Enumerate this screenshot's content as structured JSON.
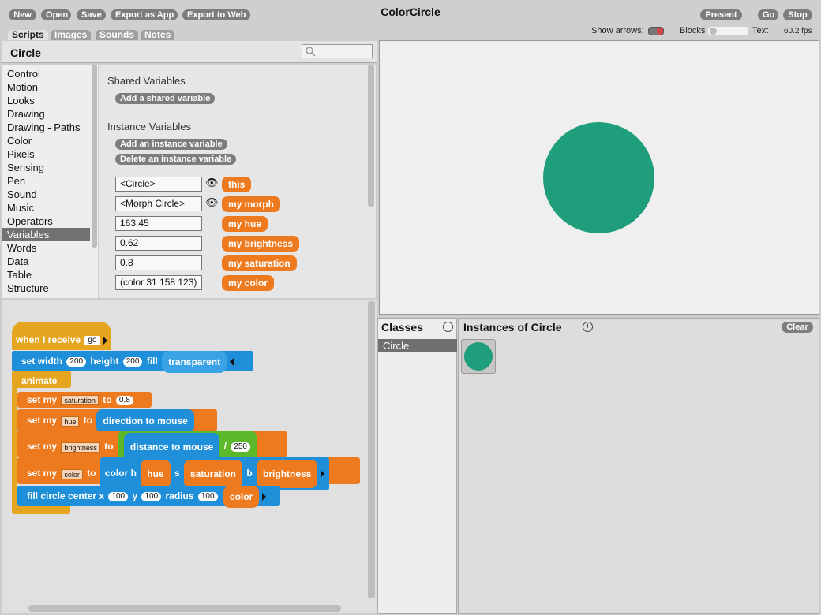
{
  "toolbar": {
    "new": "New",
    "open": "Open",
    "save": "Save",
    "export_app": "Export as App",
    "export_web": "Export to Web",
    "present": "Present",
    "go": "Go",
    "stop": "Stop"
  },
  "app_title": "ColorCircle",
  "tabs": [
    "Scripts",
    "Images",
    "Sounds",
    "Notes"
  ],
  "status": {
    "show_arrows": "Show arrows:",
    "blocks": "Blocks",
    "text": "Text",
    "fps": "60.2 fps"
  },
  "sprite_name": "Circle",
  "categories": [
    "Control",
    "Motion",
    "Looks",
    "Drawing",
    "Drawing - Paths",
    "Color",
    "Pixels",
    "Sensing",
    "Pen",
    "Sound",
    "Music",
    "Operators",
    "Variables",
    "Words",
    "Data",
    "Table",
    "Structure"
  ],
  "selected_category": "Variables",
  "variables_panel": {
    "shared_title": "Shared Variables",
    "add_shared": "Add a shared variable",
    "instance_title": "Instance Variables",
    "add_instance": "Add an instance variable",
    "delete_instance": "Delete an instance variable",
    "vars": [
      {
        "value": "<Circle>",
        "name": "this"
      },
      {
        "value": "<Morph Circle>",
        "name": "my morph"
      },
      {
        "value": "163.45",
        "name": "my hue"
      },
      {
        "value": "0.62",
        "name": "my brightness"
      },
      {
        "value": "0.8",
        "name": "my saturation"
      },
      {
        "value": "(color 31 158 123)",
        "name": "my color"
      }
    ]
  },
  "script": {
    "hat": "when I receive",
    "hat_msg": "go",
    "set_width": "set width",
    "width": "200",
    "height_lbl": "height",
    "height": "200",
    "fill": "fill",
    "transparent": "transparent",
    "animate": "animate",
    "set_my": "set my",
    "to": "to",
    "saturation_dd": "saturation",
    "saturation_val": "0.8",
    "hue_dd": "hue",
    "direction_to_mouse": "direction to mouse",
    "brightness_dd": "brightness",
    "distance_to_mouse": "distance to mouse",
    "divide": "/",
    "divisor": "250",
    "color_dd": "color",
    "color_h": "color h",
    "hue": "hue",
    "s": "s",
    "saturation": "saturation",
    "b": "b",
    "brightness": "brightness",
    "fill_circle": "fill circle center x",
    "cx": "100",
    "y": "y",
    "cy": "100",
    "radius": "radius",
    "r": "100",
    "color": "color"
  },
  "classes": {
    "title": "Classes",
    "items": [
      "Circle"
    ]
  },
  "instances": {
    "title": "Instances of Circle",
    "clear": "Clear"
  },
  "colors": {
    "circle": "#1e9e7b",
    "orange": "#ee7a1f",
    "blue": "#1f8fd9",
    "green": "#5ab82a",
    "yellow": "#e5a51f"
  }
}
